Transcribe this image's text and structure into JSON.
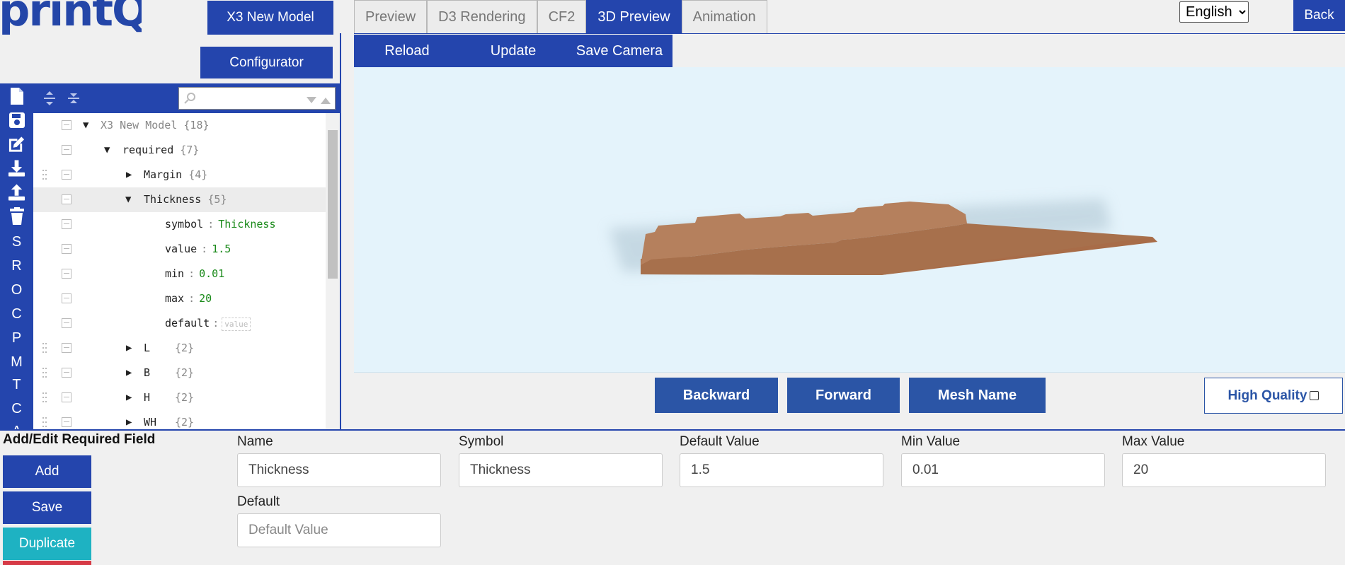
{
  "app": {
    "logo_text": "printQ",
    "brand_color": "#2445ad"
  },
  "header": {
    "model_button": "X3 New Model",
    "configurator_button": "Configurator",
    "back_button": "Back",
    "language": {
      "selected": "English"
    },
    "tabs": [
      {
        "label": "Preview",
        "active": false
      },
      {
        "label": "D3 Rendering",
        "active": false
      },
      {
        "label": "CF2",
        "active": false
      },
      {
        "label": "3D Preview",
        "active": true
      },
      {
        "label": "Animation",
        "active": false
      }
    ]
  },
  "toolbar": {
    "reload": "Reload",
    "update": "Update",
    "save_camera": "Save Camera"
  },
  "viewer_controls": {
    "backward": "Backward",
    "forward": "Forward",
    "mesh_name": "Mesh Name",
    "high_quality": "High Quality"
  },
  "side_tools": {
    "icons": [
      "new-file-icon",
      "save-icon",
      "edit-icon",
      "download-icon",
      "upload-icon",
      "trash-icon"
    ],
    "letters": [
      "S",
      "R",
      "O",
      "C",
      "P",
      "M",
      "T",
      "C",
      "A"
    ]
  },
  "tree": {
    "root": {
      "key": "X3 New Model",
      "count": "{18}"
    },
    "required": {
      "key": "required",
      "count": "{7}"
    },
    "margin": {
      "key": "Margin",
      "count": "{4}"
    },
    "thickness": {
      "key": "Thickness",
      "count": "{5}"
    },
    "fields": {
      "symbol": {
        "key": "symbol",
        "value": "Thickness"
      },
      "value": {
        "key": "value",
        "value": "1.5"
      },
      "min": {
        "key": "min",
        "value": "0.01"
      },
      "max": {
        "key": "max",
        "value": "20"
      },
      "default": {
        "key": "default",
        "placeholder": "value"
      }
    },
    "l": {
      "key": "L",
      "count": "{2}"
    },
    "b": {
      "key": "B",
      "count": "{2}"
    },
    "h": {
      "key": "H",
      "count": "{2}"
    },
    "wh": {
      "key": "WH",
      "count": "{2}"
    },
    "colon": ":"
  },
  "form": {
    "title": "Add/Edit Required Field",
    "buttons": {
      "add": "Add",
      "save": "Save",
      "duplicate": "Duplicate"
    },
    "fields": {
      "name": {
        "label": "Name",
        "value": "Thickness"
      },
      "symbol": {
        "label": "Symbol",
        "value": "Thickness"
      },
      "default_value": {
        "label": "Default Value",
        "value": "1.5"
      },
      "min_value": {
        "label": "Min Value",
        "value": "0.01"
      },
      "max_value": {
        "label": "Max Value",
        "value": "20"
      },
      "default": {
        "label": "Default",
        "value": "",
        "placeholder": "Default Value"
      }
    }
  }
}
